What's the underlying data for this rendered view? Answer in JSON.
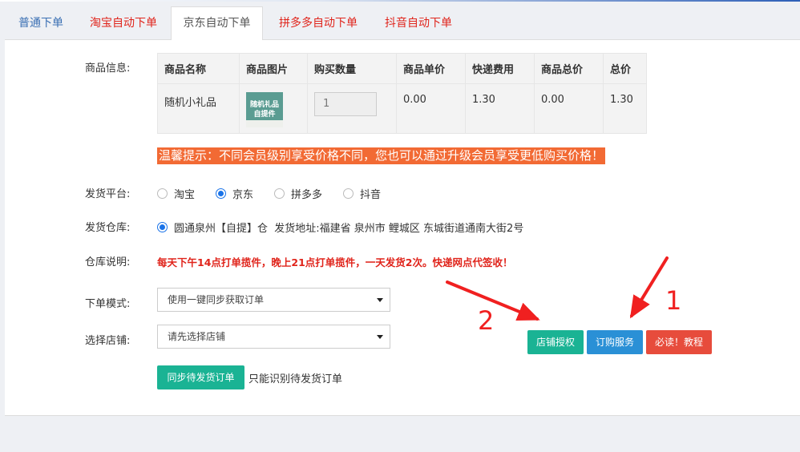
{
  "tabs": [
    {
      "label": "普通下单"
    },
    {
      "label": "淘宝自动下单"
    },
    {
      "label": "京东自动下单"
    },
    {
      "label": "拼多多自动下单"
    },
    {
      "label": "抖音自动下单"
    }
  ],
  "active_tab": "京东自动下单",
  "goods": {
    "label": "商品信息:",
    "columns": [
      "商品名称",
      "商品图片",
      "购买数量",
      "商品单价",
      "快递费用",
      "商品总价",
      "总价"
    ],
    "row": {
      "name": "随机小礼品",
      "image_text_1": "随机礼品",
      "image_text_2": "自提件",
      "quantity": "1",
      "unit_price": "0.00",
      "shipping": "1.30",
      "goods_total": "0.00",
      "total": "1.30"
    }
  },
  "notice": "温馨提示：不同会员级别享受价格不同，您也可以通过升级会员享受更低购买价格！",
  "platform": {
    "label": "发货平台:",
    "options": [
      "淘宝",
      "京东",
      "拼多多",
      "抖音"
    ],
    "selected": "京东"
  },
  "warehouse": {
    "label": "发货仓库:",
    "option": "圆通泉州【自提】仓  发货地址:福建省 泉州市 鲤城区 东城街道通南大街2号"
  },
  "warehouse_note": {
    "label": "仓库说明:",
    "text": "每天下午14点打单揽件，晚上21点打单揽件，一天发货2次。快递网点代签收！"
  },
  "order_mode": {
    "label": "下单模式:",
    "value": "使用一键同步获取订单"
  },
  "store": {
    "label": "选择店铺:",
    "value": "请先选择店铺"
  },
  "buttons": {
    "sync": "同步待发货订单",
    "sync_hint": "只能识别待发货订单",
    "auth": "店铺授权",
    "order_service": "订购服务",
    "must_read": "必读！教程"
  },
  "annotations": {
    "num1": "1",
    "num2": "2",
    "color": "#f02020"
  }
}
